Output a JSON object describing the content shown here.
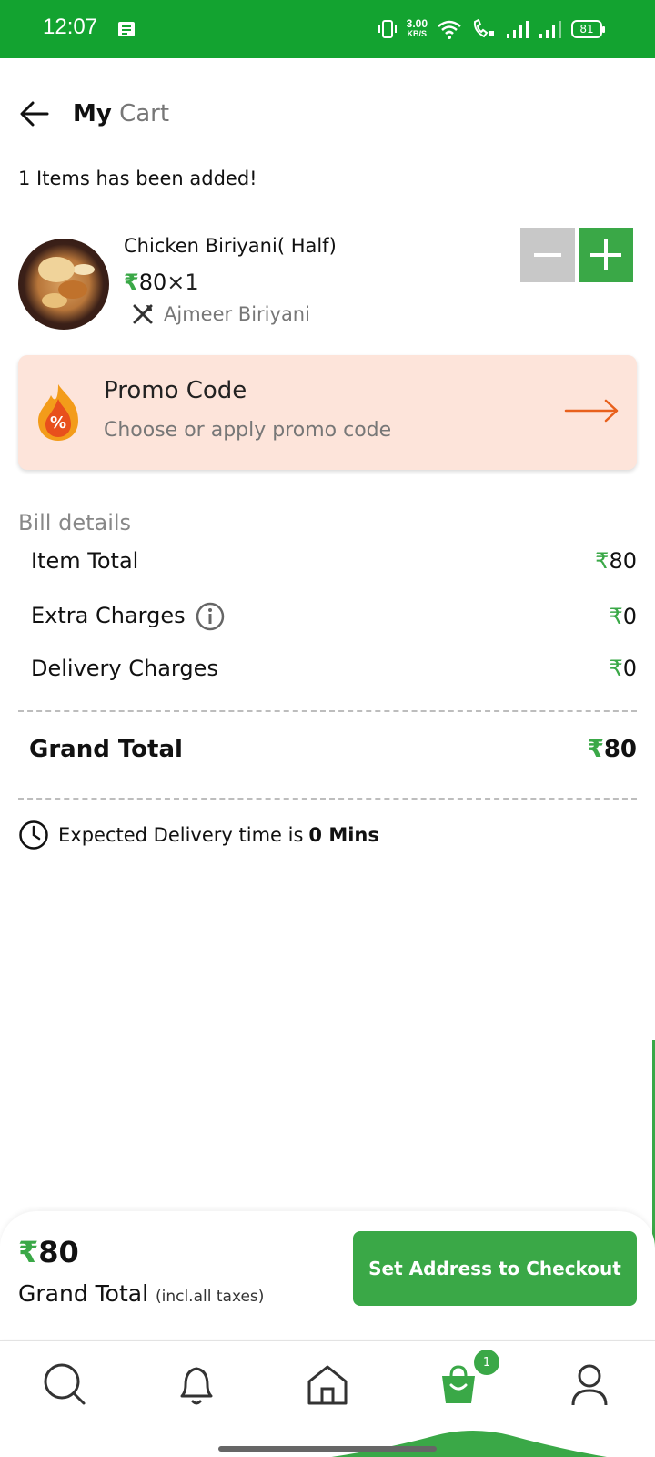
{
  "status_bar": {
    "time": "12:07",
    "speed_value": "3.00",
    "speed_unit": "KB/S",
    "battery": "81"
  },
  "header": {
    "title_bold": "My",
    "title_light": "Cart"
  },
  "cart": {
    "added_note": "1 Items has been added!",
    "item": {
      "name": "Chicken Biriyani( Half)",
      "currency": "₹",
      "price": "80",
      "qty": "×1",
      "restaurant": "Ajmeer Biriyani"
    }
  },
  "promo": {
    "title": "Promo Code",
    "subtitle": "Choose or apply promo code",
    "badge_symbol": "%"
  },
  "bill": {
    "title": "Bill details",
    "rows": [
      {
        "label": "Item Total",
        "currency": "₹",
        "value": "80"
      },
      {
        "label": "Extra Charges",
        "currency": "₹",
        "value": "0"
      },
      {
        "label": "Delivery Charges",
        "currency": "₹",
        "value": "0"
      }
    ],
    "grand_label": "Grand Total",
    "grand_currency": "₹",
    "grand_value": "80"
  },
  "delivery": {
    "text": "Expected Delivery time is",
    "value": "0 Mins"
  },
  "footer": {
    "currency": "₹",
    "total": "80",
    "label": "Grand Total",
    "label_note": "(incl.all taxes)",
    "checkout_label": "Set Address to Checkout"
  },
  "bottom_nav": {
    "items": [
      "search-icon",
      "bell-icon",
      "home-icon",
      "cart-icon",
      "profile-icon"
    ],
    "cart_badge": "1"
  },
  "colors": {
    "brand_green": "#3aa847",
    "status_green": "#13a330",
    "promo_bg": "#fde4da",
    "promo_arrow": "#e8601c"
  }
}
